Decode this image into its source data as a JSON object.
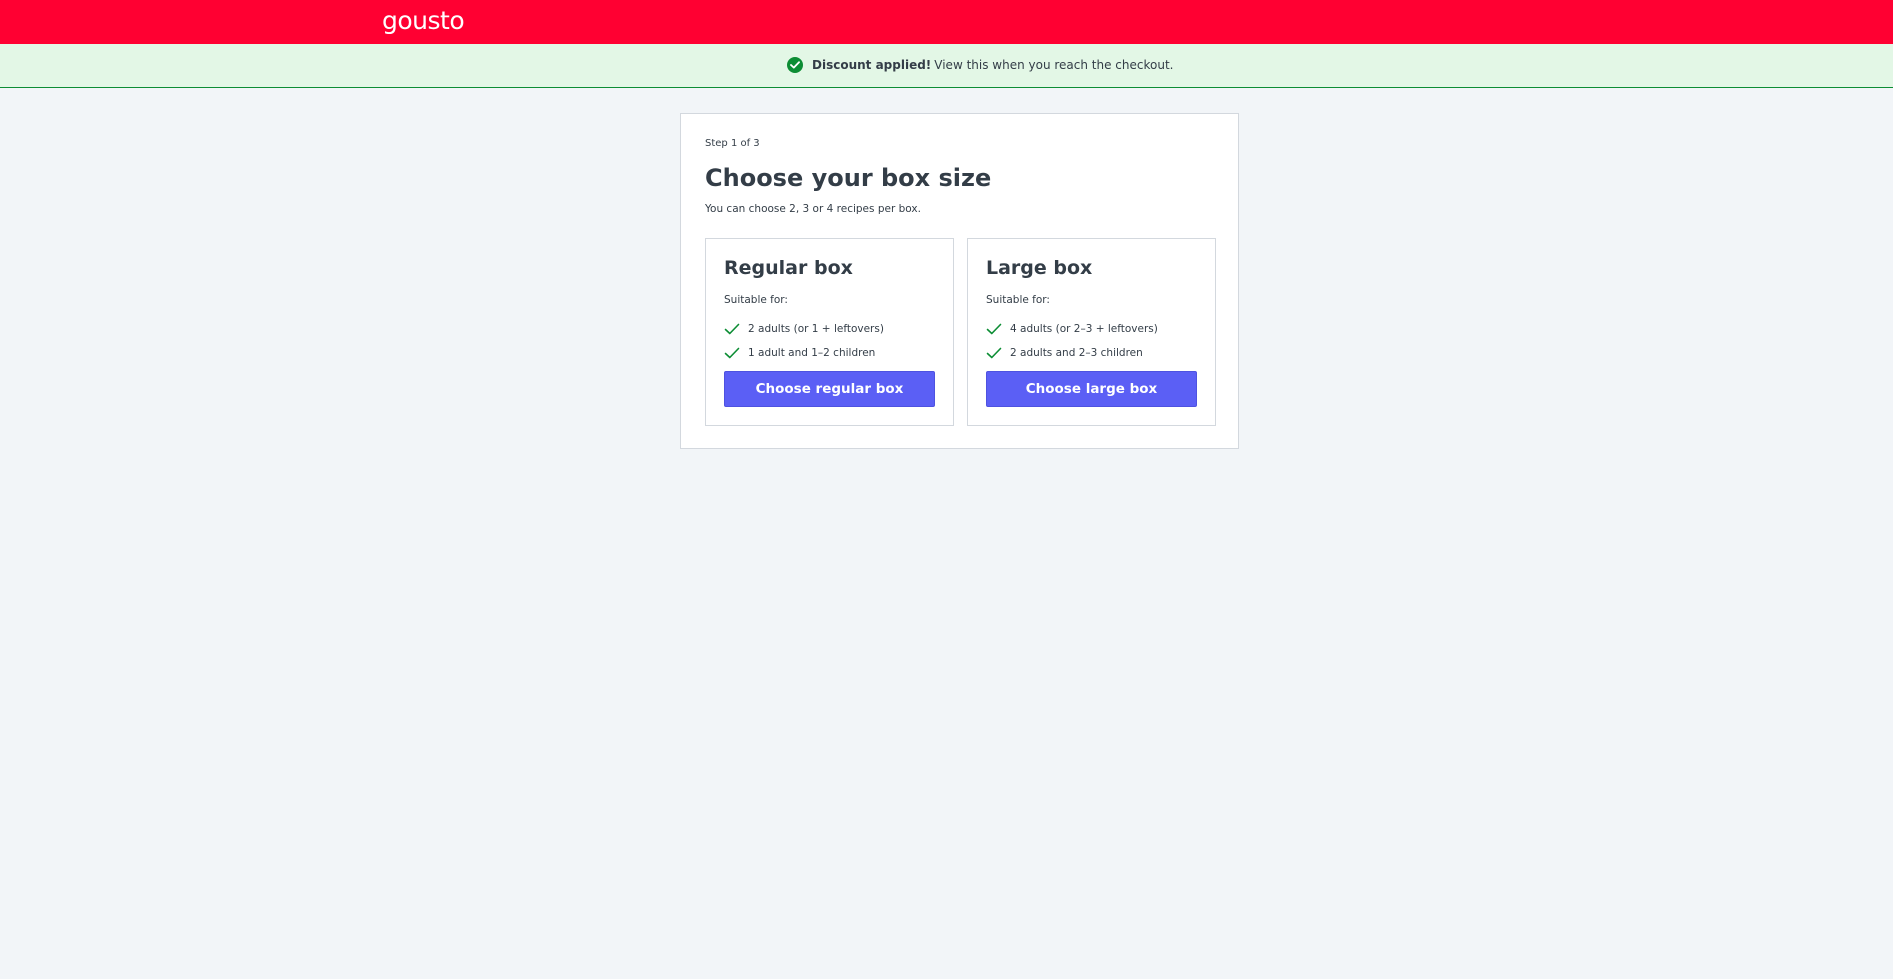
{
  "header": {
    "logo_text": "gousto",
    "brand_color": "#ff0032"
  },
  "banner": {
    "icon": "check-circle-icon",
    "strong_text": "Discount applied!",
    "text": "View this when you reach the checkout.",
    "background_color": "#e3f7e6",
    "accent_color": "#0c8d34"
  },
  "card": {
    "step": "Step 1 of 3",
    "title": "Choose your box size",
    "subtitle": "You can choose 2, 3 or 4 recipes per box.",
    "boxes": [
      {
        "title": "Regular box",
        "suitable_label": "Suitable for:",
        "features": [
          "2 adults (or 1 + leftovers)",
          "1 adult and 1–2 children"
        ],
        "button_label": "Choose regular box"
      },
      {
        "title": "Large box",
        "suitable_label": "Suitable for:",
        "features": [
          "4 adults (or 2–3 + leftovers)",
          "2 adults and 2–3 children"
        ],
        "button_label": "Choose large box"
      }
    ],
    "button_color": "#5b5ff5",
    "tick_color": "#0c8d34",
    "tick_icon": "checkmark-icon"
  }
}
